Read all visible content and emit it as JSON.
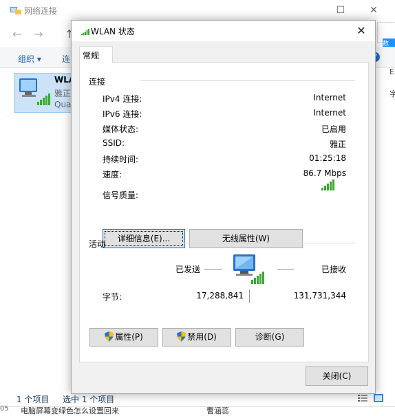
{
  "background": {
    "title": "网络连接",
    "menu_org": "组织 ▾",
    "menu_connect": "连",
    "item": {
      "name": "WLA",
      "sub1": "雅正",
      "sub2": "Qua"
    },
    "status_count": "1 个项目",
    "status_selected": "选中 1 个项目",
    "side_e": "E",
    "side_x": "字",
    "help": "?",
    "taskbar_num": "05",
    "taskbar_text": "电脑屏幕变绿色怎么设置回来",
    "taskbar_text2": "曹涵蕊",
    "right_tab": "数"
  },
  "dialog": {
    "title": "WLAN 状态",
    "tab": "常规",
    "connection_section": "连接",
    "rows": [
      {
        "label": "IPv4 连接:",
        "value": "Internet"
      },
      {
        "label": "IPv6 连接:",
        "value": "Internet"
      },
      {
        "label": "媒体状态:",
        "value": "已启用"
      },
      {
        "label": "SSID:",
        "value": "雅正"
      },
      {
        "label": "持续时间:",
        "value": "01:25:18"
      },
      {
        "label": "速度:",
        "value": "86.7 Mbps"
      }
    ],
    "signal_label": "信号质量:",
    "details_button": "详细信息(E)...",
    "wireless_props_button": "无线属性(W)",
    "activity_section": "活动",
    "sent_label": "已发送",
    "received_label": "已接收",
    "bytes_label": "字节:",
    "bytes_sent": "17,288,841",
    "bytes_received": "131,731,344",
    "properties_button": "属性(P)",
    "disable_button": "禁用(D)",
    "diagnose_button": "诊断(G)",
    "close_button": "关闭(C)"
  },
  "signal_bars": 5,
  "colors": {
    "accent": "#0078d7",
    "signal": "#3aa832",
    "shield_blue": "#2f6fd1",
    "shield_yellow": "#f2c200"
  }
}
